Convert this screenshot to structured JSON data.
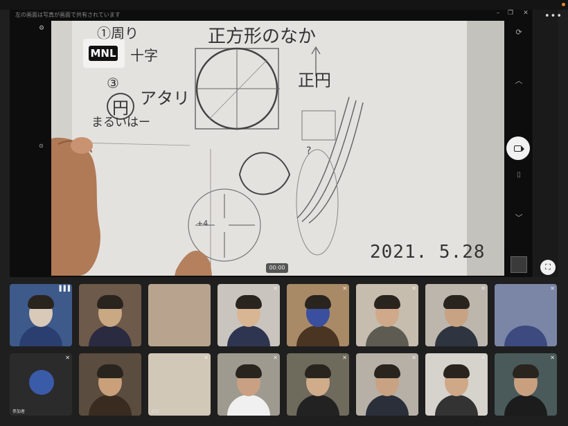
{
  "window": {
    "title": "左の画面は写真が画面で共有されています",
    "min_icon": "–",
    "max_icon": "❐",
    "close_icon": "✕"
  },
  "left_strip": {
    "icon_a": "⚙",
    "icon_b": "⊙"
  },
  "video": {
    "badge": "MNL",
    "timer": "00:00",
    "date_stamp": "2021. 5.28",
    "note_title": "正方形のなか",
    "note_circle": "正円",
    "note_left_a": "①周り",
    "note_left_b": "十字",
    "note_left_c": "③",
    "note_left_d": "円",
    "note_left_e": "アタリ",
    "note_left_f": "まるいはー",
    "note_plus": "+4",
    "note_q": "?"
  },
  "controls": {
    "more": "•••",
    "rotate": "⟳",
    "chevron_up": "︿",
    "snapshot": "⌷",
    "chevron_down": "﹀",
    "fullscreen": "⛶"
  },
  "participants": [
    {
      "name": "",
      "mic": "▐▐▐",
      "bg": "#3d5a8a",
      "face": "#d8c9b8",
      "shirt": "#2a3e70"
    },
    {
      "name": "",
      "mic": "",
      "bg": "#6e5a4a",
      "face": "#c9a983",
      "shirt": "#2a2a40"
    },
    {
      "name": "",
      "mic": "",
      "bg": "#b8a48e",
      "face": "",
      "shirt": ""
    },
    {
      "name": "",
      "mic": "✕",
      "bg": "#c9c4bd",
      "face": "#d8b593",
      "shirt": "#2e3550"
    },
    {
      "name": "",
      "mic": "✕",
      "bg": "#a88a66",
      "face": "#3b4fa0",
      "shirt": "#4a3522"
    },
    {
      "name": "",
      "mic": "✕",
      "bg": "#c6bdaf",
      "face": "#cfa989",
      "shirt": "#5e5c52"
    },
    {
      "name": "",
      "mic": "✕",
      "bg": "#bcb6ad",
      "face": "#c7a383",
      "shirt": "#2e3440"
    },
    {
      "name": "",
      "mic": "✕",
      "bg": "#7b86a6",
      "face": "",
      "shirt": "#3d4a80"
    },
    {
      "name": "参加者",
      "mic": "✕",
      "bg": "#2b2b2b",
      "face": "#3a5ba8",
      "shirt": ""
    },
    {
      "name": "",
      "mic": "",
      "bg": "#5a4c3e",
      "face": "#c9a07a",
      "shirt": "#3a2b20"
    },
    {
      "name": "自宅",
      "mic": "✕",
      "bg": "#d2c8b8",
      "face": "",
      "shirt": ""
    },
    {
      "name": "",
      "mic": "✕",
      "bg": "#9e9a90",
      "face": "#c9a083",
      "shirt": "#f0f0f0"
    },
    {
      "name": "",
      "mic": "✕",
      "bg": "#6e6a5c",
      "face": "#d0ac8a",
      "shirt": "#222"
    },
    {
      "name": "",
      "mic": "✕",
      "bg": "#b6b0a6",
      "face": "#c8a282",
      "shirt": "#2a2f3a"
    },
    {
      "name": "",
      "mic": "✕",
      "bg": "#d6d2cc",
      "face": "#cfa888",
      "shirt": "#333"
    },
    {
      "name": "",
      "mic": "✕",
      "bg": "#4a5a5a",
      "face": "#c9a07f",
      "shirt": "#1c1c1c"
    }
  ]
}
